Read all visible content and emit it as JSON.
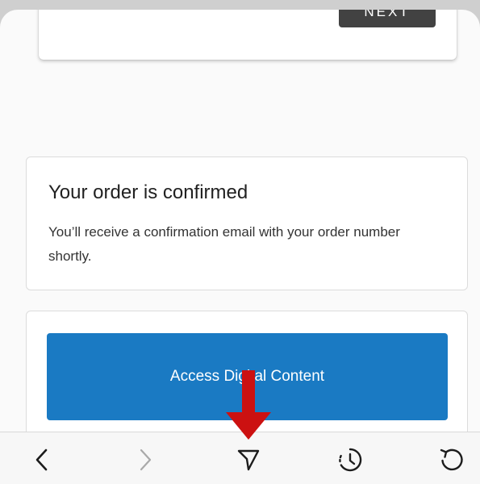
{
  "top_card": {
    "next_label": "NEXT"
  },
  "confirmation": {
    "title": "Your order is confirmed",
    "message": "You’ll receive a confirmation email with your order number shortly."
  },
  "access": {
    "button_label": "Access Digital Content"
  },
  "bottom_nav": {
    "items": [
      {
        "name": "back",
        "icon": "chevron-left-icon"
      },
      {
        "name": "forward",
        "icon": "chevron-right-icon"
      },
      {
        "name": "share",
        "icon": "send-icon"
      },
      {
        "name": "history",
        "icon": "history-icon"
      },
      {
        "name": "reload",
        "icon": "reload-icon"
      }
    ]
  },
  "colors": {
    "primary": "#1a7ac3",
    "next_button": "#424242",
    "annotation_arrow": "#cc1111"
  }
}
